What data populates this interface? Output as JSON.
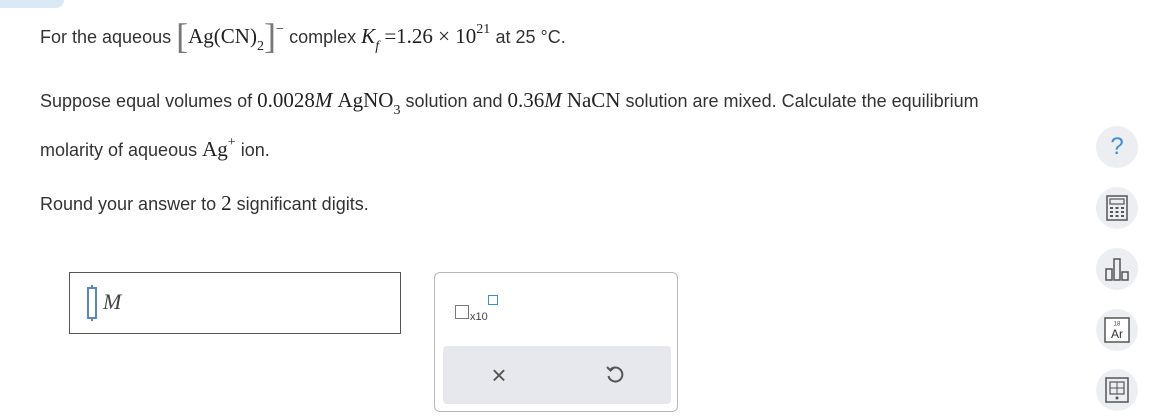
{
  "question": {
    "line1": {
      "prefix": "For the aqueous",
      "complex_ag": "Ag",
      "complex_cn": "CN",
      "complex_sub": "2",
      "complex_sup": "−",
      "middle": "complex",
      "kf_symbol": "K",
      "kf_sub": "f",
      "kf_value": "=1.26 × 10",
      "kf_exponent": "21",
      "suffix": "at 25 °C."
    },
    "line2": {
      "part1": "Suppose equal volumes of",
      "conc1": "0.0028",
      "unit1": "M",
      "salt1": "AgNO",
      "salt1_sub": "3",
      "part2": "solution and",
      "conc2": "0.36",
      "unit2": "M",
      "salt2": "NaCN",
      "part3": "solution are mixed. Calculate the equilibrium"
    },
    "line3": {
      "part1": "molarity of aqueous",
      "ion": "Ag",
      "ion_charge": "+",
      "part2": "ion."
    },
    "line4": {
      "part1": "Round your answer to",
      "digits": "2",
      "part2": "significant digits."
    }
  },
  "answer": {
    "value": "",
    "unit": "M"
  },
  "tools": {
    "sci_notation_label": "x10",
    "clear_symbol": "×"
  },
  "side_toolbar": {
    "help_symbol": "?",
    "ptable_number": "18",
    "ptable_symbol": "Ar"
  },
  "colors": {
    "accent": "#3d8fd0",
    "text": "#333333",
    "icon_bg": "#eceef2"
  }
}
